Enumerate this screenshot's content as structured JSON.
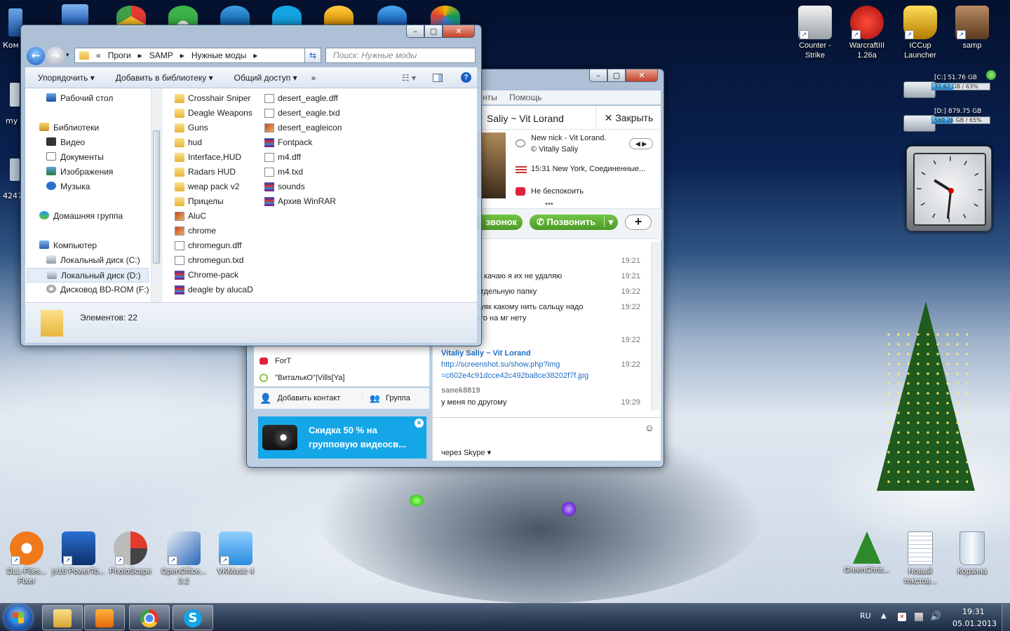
{
  "desktop": {
    "left_partial_labels": [
      "Ком",
      "my",
      "4247"
    ],
    "top_right_icons": [
      {
        "label": "Counter - Strike",
        "icon": "counter-strike-icon"
      },
      {
        "label": "WarcraftIII 1.26a",
        "icon": "warcraft-icon"
      },
      {
        "label": "ICCup Launcher",
        "icon": "iccup-icon"
      },
      {
        "label": "samp",
        "icon": "samp-icon"
      }
    ],
    "bottom_icons": [
      {
        "label": "DLL-Files... Fixer",
        "icon": "dll-fixer-icon"
      },
      {
        "label": "jv16 PowerTo...",
        "icon": "jv16-icon"
      },
      {
        "label": "PhotoScape",
        "icon": "photoscape-icon"
      },
      {
        "label": "OpenOffice... 3.2",
        "icon": "openoffice-icon"
      },
      {
        "label": "VKMusic 4",
        "icon": "vkmusic-icon"
      }
    ],
    "bottom_right_icons": [
      {
        "label": "GreenChris...",
        "icon": "christmas-tree-icon"
      },
      {
        "label": "Новый текстов...",
        "icon": "text-file-icon"
      },
      {
        "label": "Корзина",
        "icon": "recycle-bin-icon"
      }
    ]
  },
  "drive_gadget": {
    "c_label": "[C:] 51.76 GB",
    "c_free": "32.62 GB / 63%",
    "c_fill": 0.37,
    "d_label": "[D:] 879.75 GB",
    "d_free": "569.26 GB / 65%",
    "d_fill": 0.35
  },
  "clock_gadget": {
    "hour_angle": 302,
    "minute_angle": 186
  },
  "explorer": {
    "breadcrumb": [
      "«",
      "Проги",
      "SAMP",
      "Нужные моды"
    ],
    "search_placeholder": "Поиск: Нужные моды",
    "toolbar": [
      "Упорядочить ▾",
      "Добавить в библиотеку ▾",
      "Общий доступ ▾",
      "»"
    ],
    "nav": [
      {
        "label": "Рабочий стол",
        "icon": "desktop-icon"
      },
      {
        "label": "Библиотеки",
        "icon": "libraries-icon"
      },
      {
        "label": "Видео",
        "icon": "video-icon"
      },
      {
        "label": "Документы",
        "icon": "documents-icon"
      },
      {
        "label": "Изображения",
        "icon": "pictures-icon"
      },
      {
        "label": "Музыка",
        "icon": "music-icon"
      },
      {
        "label": "Домашняя группа",
        "icon": "homegroup-icon"
      },
      {
        "label": "Компьютер",
        "icon": "computer-icon"
      },
      {
        "label": "Локальный диск (C:)",
        "icon": "drive-icon"
      },
      {
        "label": "Локальный диск (D:)",
        "icon": "drive-icon"
      },
      {
        "label": "Дисковод BD-ROM (F:)",
        "icon": "disc-icon"
      }
    ],
    "files_col1": [
      {
        "name": "Crosshair Sniper",
        "type": "folder"
      },
      {
        "name": "Deagle Weapons",
        "type": "folder"
      },
      {
        "name": "Guns",
        "type": "folder"
      },
      {
        "name": "hud",
        "type": "folder"
      },
      {
        "name": "Interface,HUD",
        "type": "folder"
      },
      {
        "name": "Radars HUD",
        "type": "folder"
      },
      {
        "name": "weap pack v2",
        "type": "folder"
      },
      {
        "name": "Прицелы",
        "type": "folder"
      },
      {
        "name": "AluC",
        "type": "image"
      },
      {
        "name": "chrome",
        "type": "image"
      },
      {
        "name": "chromegun.dff",
        "type": "doc"
      },
      {
        "name": "chromegun.txd",
        "type": "doc"
      },
      {
        "name": "Chrome-pack",
        "type": "rar"
      },
      {
        "name": "deagle by alucaD",
        "type": "rar"
      }
    ],
    "files_col2": [
      {
        "name": "desert_eagle.dff",
        "type": "doc"
      },
      {
        "name": "desert_eagle.txd",
        "type": "doc"
      },
      {
        "name": "desert_eagleicon",
        "type": "image"
      },
      {
        "name": "Fontpack",
        "type": "rar"
      },
      {
        "name": "m4.dff",
        "type": "doc"
      },
      {
        "name": "m4.txd",
        "type": "doc"
      },
      {
        "name": "sounds",
        "type": "rar"
      },
      {
        "name": "Архив WinRAR",
        "type": "rar"
      }
    ],
    "status": "Элементов: 22"
  },
  "skype": {
    "menu_partial": "нты",
    "menu_help": "Помощь",
    "contact_title": "Saliy ~ Vit Lorand",
    "close_label": "Закрыть",
    "mood": "New nick - Vit Lorand.",
    "mood_sig": "© Vitaliy Saliy",
    "location": "15:31 New York, Соединенные...",
    "status": "Не беспокоить",
    "call_partial": "звонок",
    "call_label": "Позвонить",
    "add_label": "+",
    "messages": [
      {
        "text": "",
        "time": "19:21"
      },
      {
        "text": "ы качаю я их не удаляю",
        "time": "19:21"
      },
      {
        "text": "отдельную папку",
        "time": "19:22"
      },
      {
        "text": "хуяк какому нить сальцу надо",
        "time": "19:22"
      },
      {
        "text": "его на мг нету",
        "time": ""
      },
      {
        "text": "",
        "time": "19:22"
      }
    ],
    "sender1": "Vitaliy Saliy ~ Vit Lorand",
    "link1": "http://screenshot.su/show.php?img",
    "link2": "=c602e4c91dcce42c492ba8ce38202f7f.jpg",
    "link_time": "19:22",
    "sender2": "sanek8819",
    "msg_last": "у меня по другому",
    "msg_last_time": "19:29",
    "via": "через Skype ▾",
    "contacts": [
      "ForT",
      "\"ВиталькО\"|Vills[Ya]"
    ],
    "add_contact": "Добавить контакт",
    "group": "Группа",
    "promo": "Скидка 50 % на групповую видеосв..."
  },
  "taskbar": {
    "lang": "RU",
    "time": "19:31",
    "date": "05.01.2013",
    "apps": [
      "explorer-icon",
      "media-player-icon",
      "chrome-icon",
      "skype-icon"
    ]
  }
}
